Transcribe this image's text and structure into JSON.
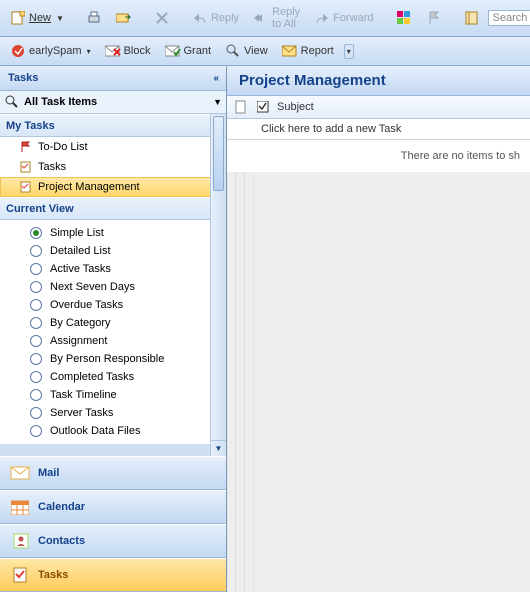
{
  "toolbar1": {
    "new": "New",
    "reply": "Reply",
    "reply_all": "Reply to All",
    "forward": "Forward",
    "search_placeholder": "Search"
  },
  "toolbar2": {
    "early": "earlySpam",
    "block": "Block",
    "grant": "Grant",
    "view": "View",
    "report": "Report"
  },
  "nav": {
    "title": "Tasks",
    "filter": "All Task Items",
    "section_mytasks": "My Tasks",
    "tree": [
      {
        "label": "To-Do List",
        "icon": "flag"
      },
      {
        "label": "Tasks",
        "icon": "task"
      },
      {
        "label": "Project Management",
        "icon": "task",
        "selected": true
      }
    ],
    "section_view": "Current View",
    "views": [
      {
        "label": "Simple List",
        "checked": true
      },
      {
        "label": "Detailed List"
      },
      {
        "label": "Active Tasks"
      },
      {
        "label": "Next Seven Days"
      },
      {
        "label": "Overdue Tasks"
      },
      {
        "label": "By Category"
      },
      {
        "label": "Assignment"
      },
      {
        "label": "By Person Responsible"
      },
      {
        "label": "Completed Tasks"
      },
      {
        "label": "Task Timeline"
      },
      {
        "label": "Server Tasks"
      },
      {
        "label": "Outlook Data Files"
      }
    ],
    "bottom": [
      {
        "name": "mail",
        "label": "Mail",
        "color": "#e8b24a"
      },
      {
        "name": "calendar",
        "label": "Calendar",
        "color": "#e8893a"
      },
      {
        "name": "contacts",
        "label": "Contacts",
        "color": "#c0504d"
      },
      {
        "name": "tasks",
        "label": "Tasks",
        "color": "#d08a2a",
        "active": true
      }
    ]
  },
  "content": {
    "title": "Project Management",
    "col_subject": "Subject",
    "newtask": "Click here to add a new Task",
    "empty": "There are no items to sh"
  }
}
